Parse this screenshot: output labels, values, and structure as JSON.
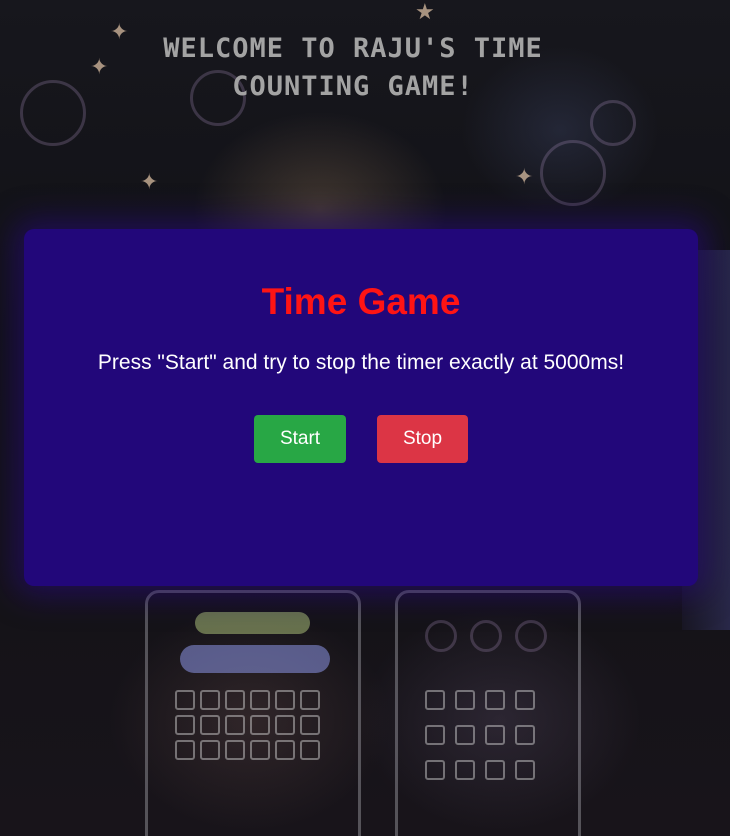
{
  "header": {
    "welcome_line1": "WELCOME TO RAJU'S TIME",
    "welcome_line2": "COUNTING GAME!"
  },
  "game": {
    "title": "Time Game",
    "instructions": "Press \"Start\" and try to stop the timer exactly at 5000ms!",
    "start_label": "Start",
    "stop_label": "Stop"
  },
  "colors": {
    "card_background": "#22077a",
    "title": "#ff1414",
    "start_button": "#28a745",
    "stop_button": "#dc3545",
    "welcome_text": "#a3a3a3"
  }
}
